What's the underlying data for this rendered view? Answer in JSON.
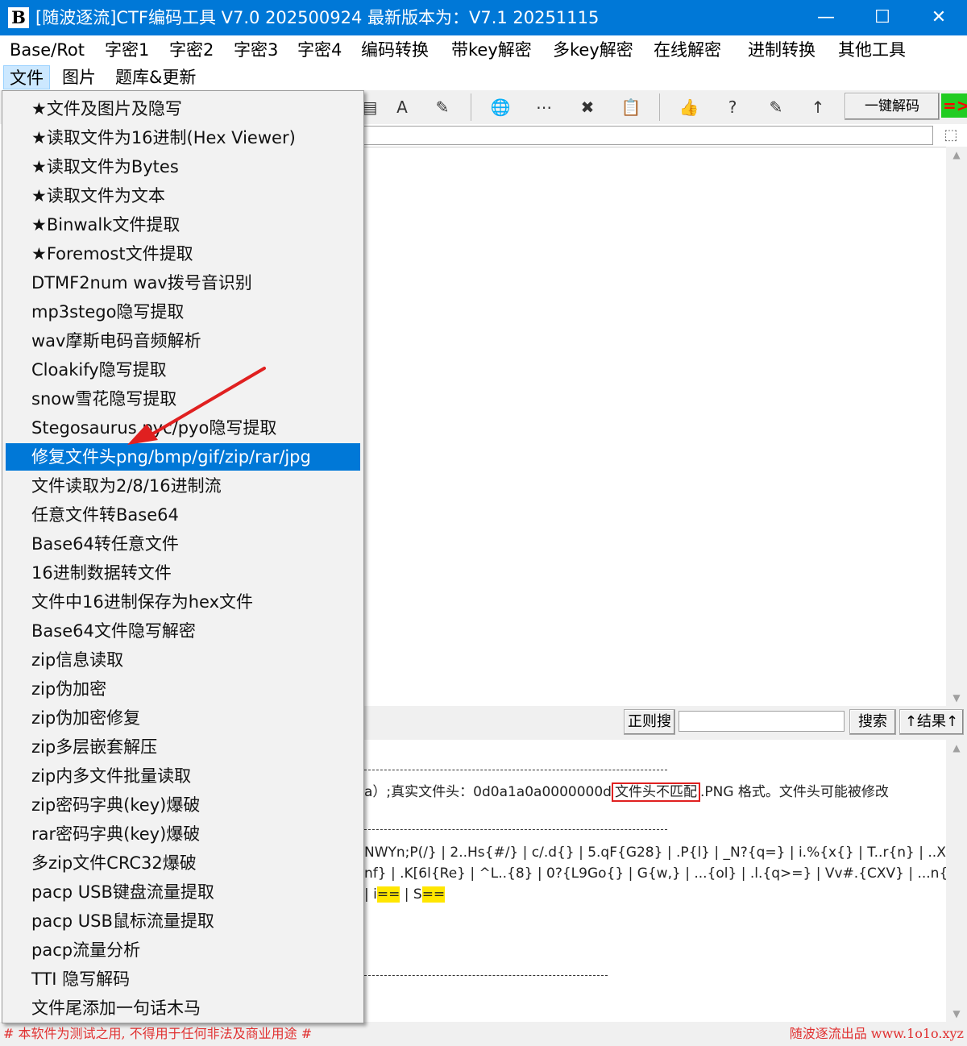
{
  "window": {
    "icon_text": "B",
    "title": "[随波逐流]CTF编码工具 V7.0 202500924    最新版本为：V7.1  20251115",
    "minimize": "—",
    "maximize": "☐",
    "close": "✕"
  },
  "menubar": {
    "items": [
      "Base/Rot",
      "字密1",
      "字密2",
      "字密3",
      "字密4",
      "编码转换",
      "带key解密",
      "多key解密",
      "在线解密",
      "进制转换",
      "其他工具"
    ]
  },
  "menubar2": {
    "items": [
      "文件",
      "图片",
      "题库&更新"
    ]
  },
  "toolbar": {
    "icons": [
      "table-icon",
      "font-icon",
      "edit-frame-icon",
      "globe-icon",
      "grid-icon",
      "tools-icon",
      "paste-icon",
      "thumbs-up-icon",
      "help-icon",
      "edit-icon",
      "up-arrow-icon"
    ],
    "glyphs": [
      "▤",
      "A",
      "✎",
      "🌐",
      "⋯",
      "✖",
      "📋",
      "👍",
      "?",
      "✎",
      "↑"
    ],
    "decode_label": "一键解码",
    "arrow_label": "=>"
  },
  "search": {
    "regex_label": "正则搜",
    "search_label": "搜索",
    "result_label": "↑结果↑"
  },
  "output": {
    "line1_prefix": "a）;真实文件头：0d0a1a0a0000000d",
    "line1_boxed": "文件头不匹配",
    "line1_suffix": ".PNG 格式。文件头可能被修改",
    "line2": "NWYn;P(/} | 2..Hs{#/} | c/.d{} | 5.qF{G28} | .P{l} | _N?{q=} | i.%{x{} | T..r{n} | ..Xw{} | Y.x",
    "line3": "nf} | .K[6l{Re} | ^L..{8} | 0?{L9Go{} | G{w,} | ...{ol} | .l.{q>=} | Vv#.{CXV} | ...n{\\} | &..{=~}",
    "line4_a": "| i",
    "line4_hl1": "==",
    "line4_b": " | S",
    "line4_hl2": "=="
  },
  "footer": {
    "left": "# 本软件为测试之用, 不得用于任何非法及商业用途 #",
    "right": "随波逐流出品 www.1o1o.xyz"
  },
  "file_menu": {
    "selected_index": 12,
    "items": [
      "★文件及图片及隐写",
      "★读取文件为16进制(Hex Viewer)",
      "★读取文件为Bytes",
      "★读取文件为文本",
      "★Binwalk文件提取",
      "★Foremost文件提取",
      "DTMF2num  wav拨号音识别",
      "mp3stego隐写提取",
      "wav摩斯电码音频解析",
      "Cloakify隐写提取",
      "snow雪花隐写提取",
      "Stegosaurus pyc/pyo隐写提取",
      "修复文件头png/bmp/gif/zip/rar/jpg",
      "文件读取为2/8/16进制流",
      "任意文件转Base64",
      "Base64转任意文件",
      "16进制数据转文件",
      "文件中16进制保存为hex文件",
      "Base64文件隐写解密",
      "zip信息读取",
      "zip伪加密",
      "zip伪加密修复",
      "zip多层嵌套解压",
      "zip内多文件批量读取",
      "zip密码字典(key)爆破",
      "rar密码字典(key)爆破",
      "多zip文件CRC32爆破",
      "pacp USB键盘流量提取",
      "pacp USB鼠标流量提取",
      "pacp流量分析",
      "TTI 隐写解码",
      "文件尾添加一句话木马"
    ]
  },
  "colors": {
    "titlebar": "#0078d7",
    "selection": "#0078d7",
    "annotation": "#e02020",
    "highlight": "#ffe600"
  }
}
